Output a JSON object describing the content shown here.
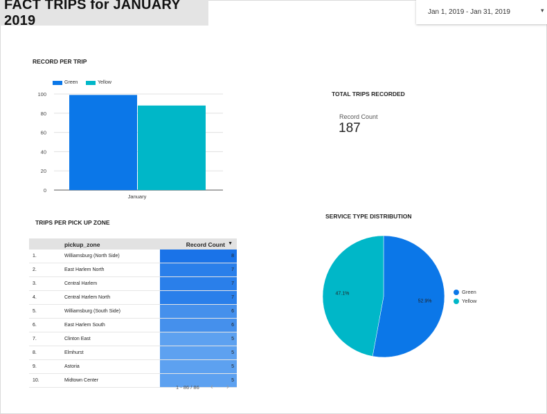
{
  "header": {
    "title": "FACT TRIPS for JANUARY 2019"
  },
  "date_range": {
    "label": "Jan 1, 2019 - Jan 31, 2019",
    "caret": "▾"
  },
  "colors": {
    "green": "#0b77e8",
    "yellow": "#00b7c8",
    "title_bg": "#e4e4e4",
    "header_bg": "#e2e2e2"
  },
  "record_per_trip": {
    "title": "RECORD PER TRIP",
    "chart_data": {
      "type": "bar",
      "categories": [
        "January"
      ],
      "series": [
        {
          "name": "Green",
          "values": [
            99
          ]
        },
        {
          "name": "Yellow",
          "values": [
            88
          ]
        }
      ],
      "ylim": [
        0,
        100
      ],
      "yticks": [
        "0",
        "20",
        "40",
        "60",
        "80",
        "100"
      ],
      "grid": true,
      "legend": "top-left"
    }
  },
  "total_trips": {
    "title": "TOTAL TRIPS RECORDED",
    "label": "Record Count",
    "value": "187"
  },
  "trips_per_zone": {
    "title": "TRIPS PER PICK UP ZONE",
    "columns": [
      "pickup_zone",
      "Record Count"
    ],
    "sort_icon": "▼",
    "rows": [
      {
        "idx": "1.",
        "zone": "Williamsburg (North Side)",
        "count": "8",
        "value": 8
      },
      {
        "idx": "2.",
        "zone": "East Harlem North",
        "count": "7",
        "value": 7
      },
      {
        "idx": "3.",
        "zone": "Central Harlem",
        "count": "7",
        "value": 7
      },
      {
        "idx": "4.",
        "zone": "Central Harlem North",
        "count": "7",
        "value": 7
      },
      {
        "idx": "5.",
        "zone": "Williamsburg (South Side)",
        "count": "6",
        "value": 6
      },
      {
        "idx": "6.",
        "zone": "East Harlem South",
        "count": "6",
        "value": 6
      },
      {
        "idx": "7.",
        "zone": "Clinton East",
        "count": "5",
        "value": 5
      },
      {
        "idx": "8.",
        "zone": "Elmhurst",
        "count": "5",
        "value": 5
      },
      {
        "idx": "9.",
        "zone": "Astoria",
        "count": "5",
        "value": 5
      },
      {
        "idx": "10.",
        "zone": "Midtown Center",
        "count": "5",
        "value": 5
      }
    ],
    "pagination": "1 - 86 / 86",
    "prev_icon": "‹",
    "next_icon": "›"
  },
  "service_type": {
    "title": "SERVICE TYPE DISTRIBUTION",
    "chart_data": {
      "type": "pie",
      "slices": [
        {
          "name": "Green",
          "value": 52.9,
          "label": "52.9%"
        },
        {
          "name": "Yellow",
          "value": 47.1,
          "label": "47.1%"
        }
      ],
      "legend": "right"
    }
  }
}
